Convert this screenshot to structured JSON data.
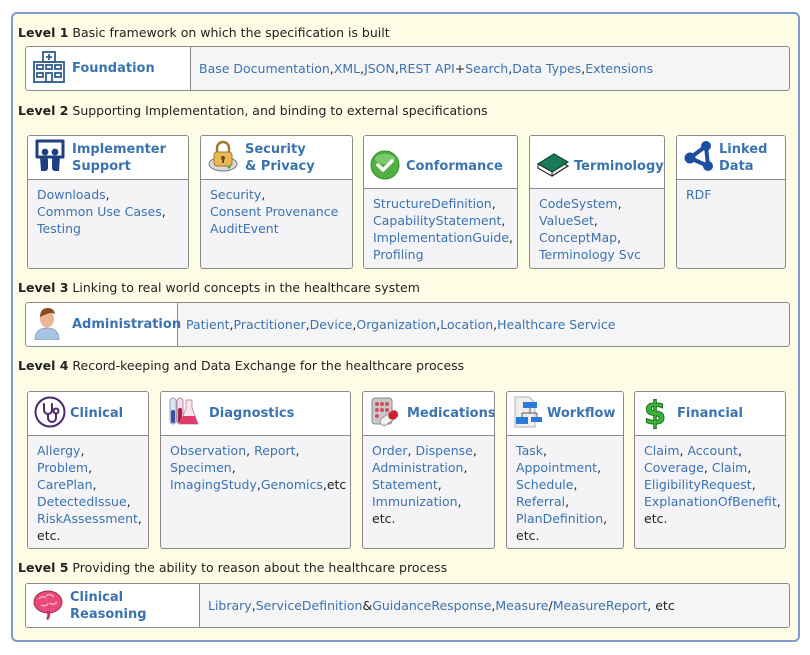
{
  "levels": [
    {
      "label": "Level 1",
      "description": "Basic framework on which the specification is built",
      "modules": [
        {
          "title": "Foundation",
          "icon": "hospital-building-icon",
          "items": [
            {
              "text": "Base Documentation",
              "link": true
            },
            {
              "text": ", ",
              "link": false
            },
            {
              "text": "XML",
              "link": true
            },
            {
              "text": ", ",
              "link": false
            },
            {
              "text": "JSON",
              "link": true
            },
            {
              "text": ", ",
              "link": false
            },
            {
              "text": "REST API",
              "link": true
            },
            {
              "text": " + ",
              "link": false
            },
            {
              "text": "Search",
              "link": true
            },
            {
              "text": ", ",
              "link": false
            },
            {
              "text": "Data Types",
              "link": true
            },
            {
              "text": ", ",
              "link": false
            },
            {
              "text": "Extensions",
              "link": true
            }
          ]
        }
      ]
    },
    {
      "label": "Level 2",
      "description": "Supporting Implementation, and binding to external specifications",
      "modules": [
        {
          "title_line1": "Implementer",
          "title_line2": "Support",
          "icon": "slideshare-users-icon",
          "lines": [
            [
              {
                "text": "Downloads",
                "link": true
              },
              {
                "text": ",",
                "link": false
              }
            ],
            [
              {
                "text": "Common Use Cases",
                "link": true
              },
              {
                "text": ",",
                "link": false
              }
            ],
            [
              {
                "text": "Testing",
                "link": true
              }
            ]
          ]
        },
        {
          "title_line1": "Security",
          "title_line2": "& Privacy",
          "icon": "padlock-icon",
          "lines": [
            [
              {
                "text": "Security",
                "link": true
              },
              {
                "text": ",",
                "link": false
              }
            ],
            [
              {
                "text": "Consent Provenance",
                "link": true
              }
            ],
            [
              {
                "text": "AuditEvent",
                "link": true
              }
            ]
          ]
        },
        {
          "title": "Conformance",
          "icon": "green-checkmark-icon",
          "lines": [
            [
              {
                "text": "StructureDefinition",
                "link": true
              },
              {
                "text": ",",
                "link": false
              }
            ],
            [
              {
                "text": "CapabilityStatement",
                "link": true
              },
              {
                "text": ",",
                "link": false
              }
            ],
            [
              {
                "text": "ImplementationGuide",
                "link": true
              },
              {
                "text": ",",
                "link": false
              }
            ],
            [
              {
                "text": "Profiling",
                "link": true
              }
            ]
          ]
        },
        {
          "title": "Terminology",
          "icon": "book-icon",
          "lines": [
            [
              {
                "text": "CodeSystem",
                "link": true
              },
              {
                "text": ",",
                "link": false
              }
            ],
            [
              {
                "text": "ValueSet",
                "link": true
              },
              {
                "text": ",",
                "link": false
              }
            ],
            [
              {
                "text": "ConceptMap",
                "link": true
              },
              {
                "text": ",",
                "link": false
              }
            ],
            [
              {
                "text": "Terminology Svc",
                "link": true
              }
            ]
          ]
        },
        {
          "title_line1": "Linked",
          "title_line2": "Data",
          "icon": "linked-nodes-icon",
          "lines": [
            [
              {
                "text": "RDF",
                "link": true
              }
            ]
          ]
        }
      ]
    },
    {
      "label": "Level 3",
      "description": "Linking to real world concepts in the healthcare system",
      "modules": [
        {
          "title": "Administration",
          "icon": "person-avatar-icon",
          "items": [
            {
              "text": "Patient",
              "link": true
            },
            {
              "text": ", ",
              "link": false
            },
            {
              "text": "Practitioner",
              "link": true
            },
            {
              "text": ", ",
              "link": false
            },
            {
              "text": "Device",
              "link": true
            },
            {
              "text": ", ",
              "link": false
            },
            {
              "text": "Organization",
              "link": true
            },
            {
              "text": ", ",
              "link": false
            },
            {
              "text": "Location",
              "link": true
            },
            {
              "text": ", ",
              "link": false
            },
            {
              "text": "Healthcare Service",
              "link": true
            }
          ]
        }
      ]
    },
    {
      "label": "Level 4",
      "description": "Record-keeping and Data Exchange for the healthcare process",
      "modules": [
        {
          "title": "Clinical",
          "icon": "stethoscope-icon",
          "lines": [
            [
              {
                "text": "Allergy",
                "link": true
              },
              {
                "text": ",",
                "link": false
              }
            ],
            [
              {
                "text": "Problem",
                "link": true
              },
              {
                "text": ",",
                "link": false
              }
            ],
            [
              {
                "text": "CarePlan",
                "link": true
              },
              {
                "text": ",",
                "link": false
              }
            ],
            [
              {
                "text": "DetectedIssue",
                "link": true
              },
              {
                "text": ",",
                "link": false
              }
            ],
            [
              {
                "text": "RiskAssessment",
                "link": true
              },
              {
                "text": ",",
                "link": false
              }
            ],
            [
              {
                "text": "etc.",
                "link": false
              }
            ]
          ]
        },
        {
          "title": "Diagnostics",
          "icon": "test-tubes-flask-icon",
          "lines": [
            [
              {
                "text": "Observation",
                "link": true
              },
              {
                "text": ", ",
                "link": false
              },
              {
                "text": "Report",
                "link": true
              },
              {
                "text": ",",
                "link": false
              }
            ],
            [
              {
                "text": "Specimen",
                "link": true
              },
              {
                "text": ",",
                "link": false
              }
            ],
            [
              {
                "text": "ImagingStudy",
                "link": true
              },
              {
                "text": ",",
                "link": false
              },
              {
                "text": "Genomics",
                "link": true
              },
              {
                "text": ",etc",
                "link": false
              }
            ]
          ]
        },
        {
          "title": "Medications",
          "icon": "pills-icon",
          "lines": [
            [
              {
                "text": "Order",
                "link": true
              },
              {
                "text": ", ",
                "link": false
              },
              {
                "text": "Dispense",
                "link": true
              },
              {
                "text": ",",
                "link": false
              }
            ],
            [
              {
                "text": "Administration",
                "link": true
              },
              {
                "text": ",",
                "link": false
              }
            ],
            [
              {
                "text": "Statement",
                "link": true
              },
              {
                "text": ",",
                "link": false
              }
            ],
            [
              {
                "text": "Immunization",
                "link": true
              },
              {
                "text": ",",
                "link": false
              }
            ],
            [
              {
                "text": "etc.",
                "link": false
              }
            ]
          ]
        },
        {
          "title": "Workflow",
          "icon": "flowchart-document-icon",
          "lines": [
            [
              {
                "text": "Task",
                "link": true
              },
              {
                "text": ",",
                "link": false
              }
            ],
            [
              {
                "text": "Appointment",
                "link": true
              },
              {
                "text": ",",
                "link": false
              }
            ],
            [
              {
                "text": "Schedule",
                "link": true
              },
              {
                "text": ",",
                "link": false
              }
            ],
            [
              {
                "text": "Referral",
                "link": true
              },
              {
                "text": ",",
                "link": false
              }
            ],
            [
              {
                "text": "PlanDefinition",
                "link": true
              },
              {
                "text": ",",
                "link": false
              }
            ],
            [
              {
                "text": "etc.",
                "link": false
              }
            ]
          ]
        },
        {
          "title": "Financial",
          "icon": "dollar-sign-icon",
          "lines": [
            [
              {
                "text": "Claim",
                "link": true
              },
              {
                "text": ", ",
                "link": false
              },
              {
                "text": "Account",
                "link": true
              },
              {
                "text": ",",
                "link": false
              }
            ],
            [
              {
                "text": "Coverage",
                "link": true
              },
              {
                "text": ", ",
                "link": false
              },
              {
                "text": "Claim",
                "link": true
              },
              {
                "text": ",",
                "link": false
              }
            ],
            [
              {
                "text": "EligibilityRequest",
                "link": true
              },
              {
                "text": ",",
                "link": false
              }
            ],
            [
              {
                "text": "ExplanationOfBenefit",
                "link": true
              },
              {
                "text": ",",
                "link": false
              }
            ],
            [
              {
                "text": "etc.",
                "link": false
              }
            ]
          ]
        }
      ]
    },
    {
      "label": "Level 5",
      "description": "Providing the ability to reason about the healthcare process",
      "modules": [
        {
          "title": "Clinical Reasoning",
          "icon": "brain-icon",
          "items": [
            {
              "text": "Library",
              "link": true
            },
            {
              "text": ", ",
              "link": false
            },
            {
              "text": "ServiceDefinition",
              "link": true
            },
            {
              "text": " & ",
              "link": false
            },
            {
              "text": "GuidanceResponse",
              "link": true
            },
            {
              "text": ", ",
              "link": false
            },
            {
              "text": "Measure",
              "link": true
            },
            {
              "text": "/",
              "link": false
            },
            {
              "text": "MeasureReport",
              "link": true
            },
            {
              "text": ", etc",
              "link": false
            }
          ]
        }
      ]
    }
  ],
  "colors": {
    "link": "#3a73b0",
    "frame_border": "#7f9acb",
    "frame_background": "#fdfde6",
    "box_body": "#f5f5f5"
  }
}
